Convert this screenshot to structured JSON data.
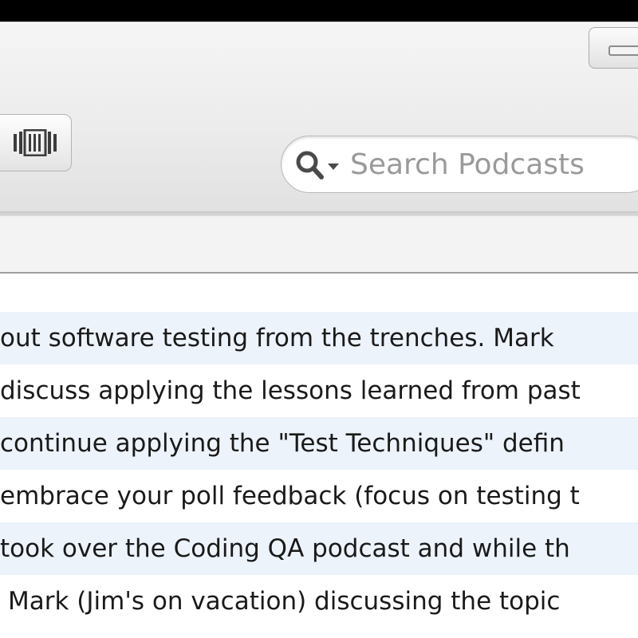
{
  "search": {
    "placeholder": "Search Podcasts",
    "icon": "search-icon"
  },
  "toolbar": {
    "view_button_icon": "cover-flow-icon",
    "window_control_icon": "minimize-icon"
  },
  "episodes": [
    "out software testing from the trenches. Mark",
    "discuss applying the lessons learned from past",
    "continue applying the \"Test Techniques\" defin",
    "embrace your poll feedback (focus on testing t",
    "took over the Coding QA podcast and while th",
    "Mark (Jim's on vacation) discussing the topic"
  ],
  "colors": {
    "row_alt": "#edf3fb",
    "placeholder": "#9a9a9a"
  }
}
